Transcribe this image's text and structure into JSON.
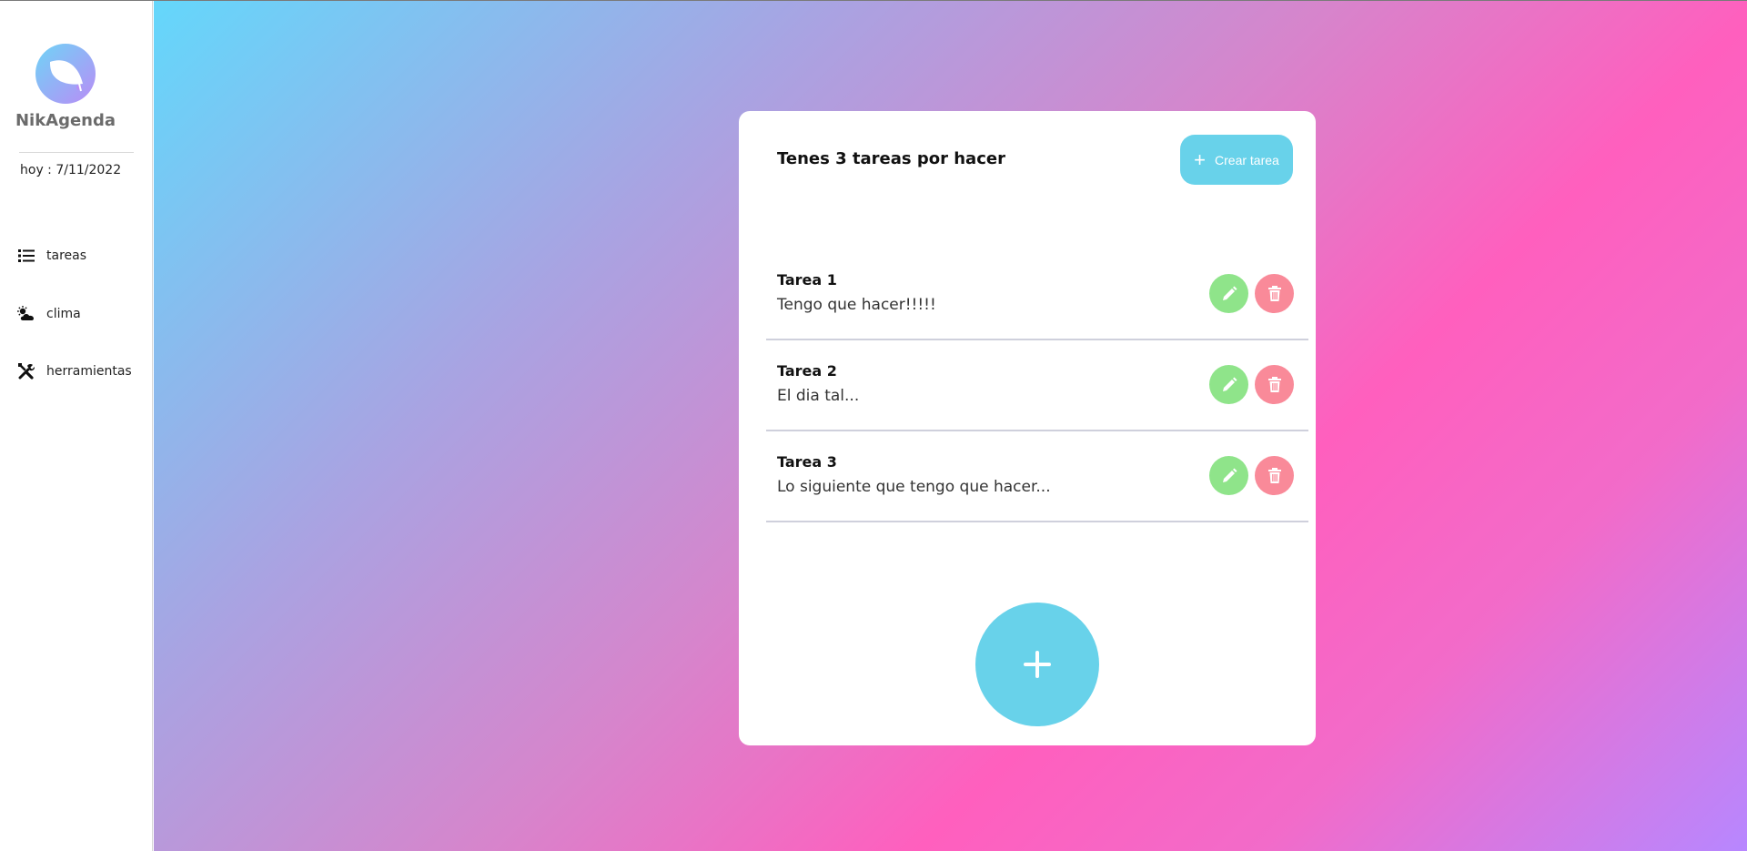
{
  "app": {
    "name": "NikAgenda",
    "date_text": "hoy : 7/11/2022"
  },
  "sidebar": {
    "items": [
      {
        "label": "tareas",
        "icon": "list-icon"
      },
      {
        "label": "clima",
        "icon": "cloud-sun-icon"
      },
      {
        "label": "herramientas",
        "icon": "tools-icon"
      }
    ]
  },
  "card": {
    "title": "Tenes 3 tareas por hacer",
    "create_label": "Crear tarea",
    "tasks": [
      {
        "title": "Tarea 1",
        "desc": "Tengo que hacer!!!!!"
      },
      {
        "title": "Tarea 2",
        "desc": "El dia tal..."
      },
      {
        "title": "Tarea 3",
        "desc": "Lo siguiente que tengo que hacer..."
      }
    ]
  },
  "colors": {
    "accent": "#68d2ea",
    "edit": "#8fe48a",
    "delete": "#f98a99",
    "gradient_start": "#64d7fb",
    "gradient_mid": "#ff5fbe",
    "gradient_end": "#b787ff"
  }
}
